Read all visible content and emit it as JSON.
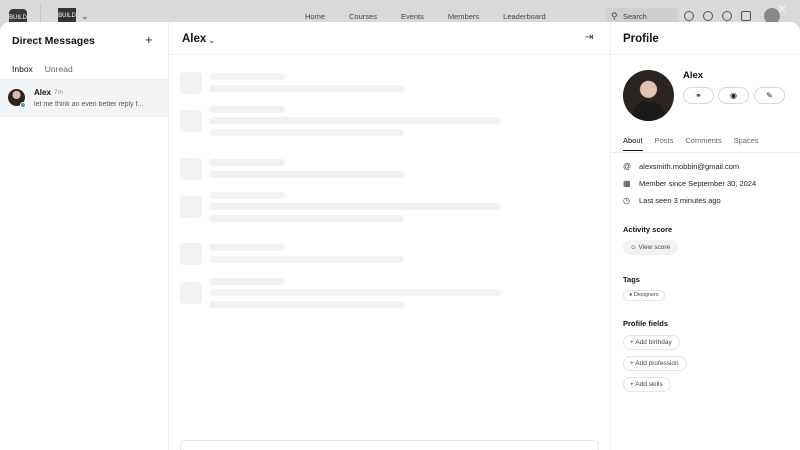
{
  "topnav": {
    "logo_text": "BUILD",
    "space_logo_text": "BUILD",
    "links": [
      "Home",
      "Courses",
      "Events",
      "Members",
      "Leaderboard"
    ],
    "search_label": "Search"
  },
  "dm": {
    "title": "Direct Messages",
    "tabs": [
      "Inbox",
      "Unread"
    ],
    "conversations": [
      {
        "name": "Alex",
        "time": "7m",
        "preview": "let me think an even better reply f..."
      }
    ]
  },
  "chat": {
    "title": "Alex"
  },
  "profile": {
    "title": "Profile",
    "name": "Alex",
    "tabs": [
      "About",
      "Posts",
      "Comments",
      "Spaces"
    ],
    "email": "alexsmith.mobbin@gmail.com",
    "member_since": "Member since September 30, 2024",
    "last_seen": "Last seen 3 minutes ago",
    "activity_title": "Activity score",
    "view_score": "View score",
    "tags_title": "Tags",
    "tags": [
      "Designers"
    ],
    "fields_title": "Profile fields",
    "fields": [
      "Add birthday",
      "Add profession",
      "Add skills"
    ]
  }
}
